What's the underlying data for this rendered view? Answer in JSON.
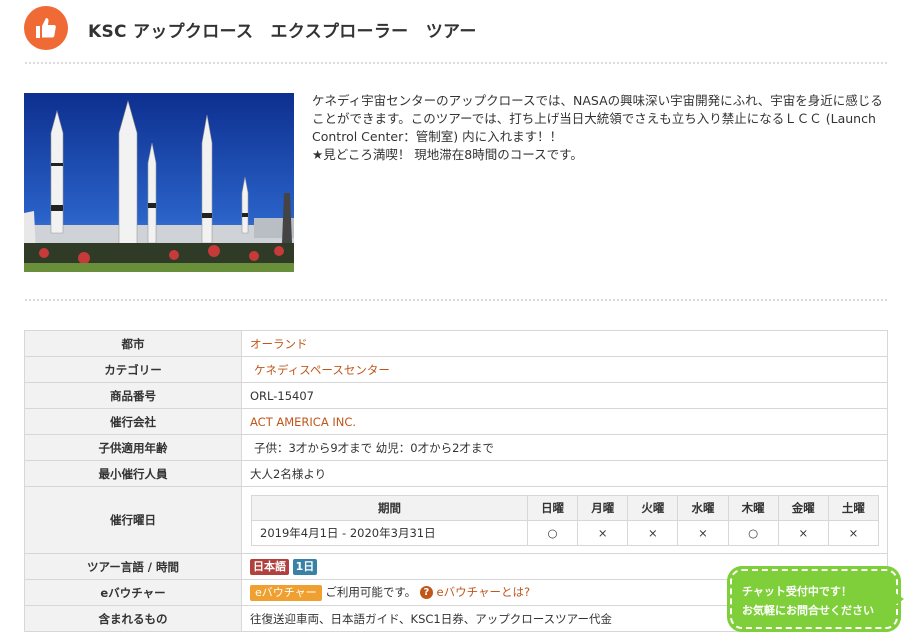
{
  "header": {
    "title": "KSC アップクロース　エクスプローラー　ツアー"
  },
  "description": {
    "line1": "ケネディ宇宙センターのアップクロースでは、NASAの興味深い宇宙開発にふれ、宇宙を身近に感じることができます。このツアーでは、打ち上げ当日大統領でさえも立ち入り禁止になるＬＣＣ (Launch Control Center：管制室) 内に入れます！！",
    "line2": "★見どころ満喫！ 現地滞在8時間のコースです。"
  },
  "info": {
    "city_label": "都市",
    "city_value": "オーランド",
    "category_label": "カテゴリー",
    "category_value": "ケネディスペースセンター",
    "product_label": "商品番号",
    "product_value": "ORL-15407",
    "company_label": "催行会社",
    "company_value": "ACT AMERICA INC.",
    "child_label": "子供適用年齢",
    "child_value": "子供：3才から9才まで 幼児：0才から2才まで",
    "min_label": "最小催行人員",
    "min_value": "大人2名様より",
    "days_label": "催行曜日",
    "lang_label": "ツアー言語 / 時間",
    "lang_badge": "日本語",
    "duration_badge": "1日",
    "voucher_label": "eバウチャー",
    "voucher_badge": "eバウチャー",
    "voucher_text": "ご利用可能です。",
    "voucher_link": "eバウチャーとは?",
    "includes_label": "含まれるもの",
    "includes_value": "往復送迎車両、日本語ガイド、KSC1日券、アップクロースツアー代金"
  },
  "schedule": {
    "period_header": "期間",
    "days": [
      "日曜",
      "月曜",
      "火曜",
      "水曜",
      "木曜",
      "金曜",
      "土曜"
    ],
    "period_value": "2019年4月1日 - 2020年3月31日",
    "marks": [
      "○",
      "×",
      "×",
      "×",
      "○",
      "×",
      "×"
    ]
  },
  "chat": {
    "line1": "チャット受付中です！",
    "line2": "お気軽にお問合せください"
  },
  "colors": {
    "accent": "#f06a35",
    "link": "#c0561a",
    "chat": "#7fcf3a"
  }
}
